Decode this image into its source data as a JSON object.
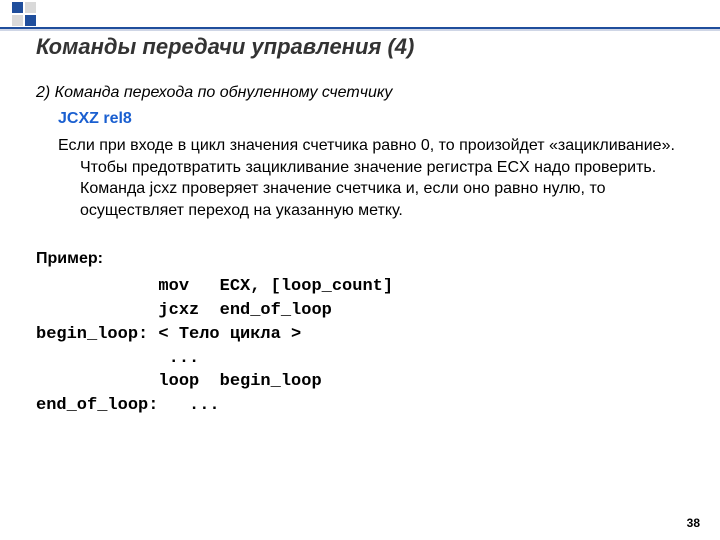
{
  "title": "Команды передачи управления (4)",
  "section": {
    "lead": "2) Команда перехода по обнуленному счетчику",
    "command": "JCXZ  rel8",
    "body": "Если при входе в цикл значения счетчика равно 0, то произойдет «зацикливание». Чтобы предотвратить зацикливание значение регистра ECX надо проверить. Команда jcxz проверяет значение счетчика и, если оно равно нулю, то осуществляет переход на указанную метку."
  },
  "example": {
    "label": "Пример:",
    "code": "            mov   ECX, [loop_count]\n            jcxz  end_of_loop\nbegin_loop: < Тело цикла >\n             ...\n            loop  begin_loop\nend_of_loop:   ..."
  },
  "page_number": "38",
  "logo_colors": {
    "a": "#1f4e9c",
    "b": "#d9d9d9"
  }
}
